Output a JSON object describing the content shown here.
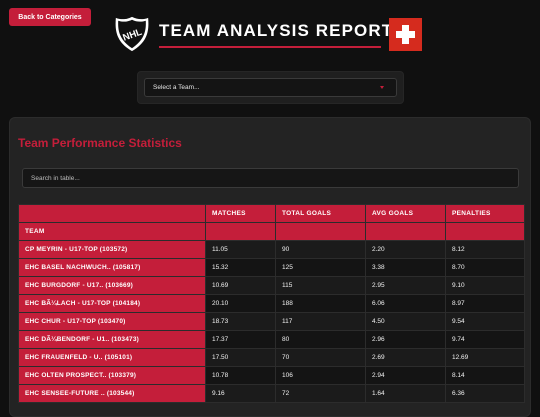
{
  "nav": {
    "back_label": "Back to Categories"
  },
  "header": {
    "title": "TEAM ANALYSIS REPORT",
    "logo_icon": "nhl-shield-icon",
    "flag_icon": "swiss-flag-icon"
  },
  "team_select": {
    "selected": "Select a Team..."
  },
  "stats": {
    "title": "Team Performance Statistics",
    "search_placeholder": "Search in table...",
    "columns": [
      "TEAM",
      "MATCHES",
      "TOTAL GOALS",
      "AVG GOALS",
      "PENALTIES"
    ],
    "rows": [
      {
        "team": "CP MEYRIN - U17-TOP (103572)",
        "matches": "11.05",
        "total_goals": "90",
        "avg_goals": "2.20",
        "penalties": "8.12"
      },
      {
        "team": "EHC BASEL NACHWUCH.. (105817)",
        "matches": "15.32",
        "total_goals": "125",
        "avg_goals": "3.38",
        "penalties": "8.70"
      },
      {
        "team": "EHC BURGDORF - U17.. (103669)",
        "matches": "10.69",
        "total_goals": "115",
        "avg_goals": "2.95",
        "penalties": "9.10"
      },
      {
        "team": "EHC BÃ¼LACH - U17-TOP (104184)",
        "matches": "20.10",
        "total_goals": "188",
        "avg_goals": "6.06",
        "penalties": "8.97"
      },
      {
        "team": "EHC CHUR - U17-TOP (103470)",
        "matches": "18.73",
        "total_goals": "117",
        "avg_goals": "4.50",
        "penalties": "9.54"
      },
      {
        "team": "EHC DÃ¼BENDORF - U1.. (103473)",
        "matches": "17.37",
        "total_goals": "80",
        "avg_goals": "2.96",
        "penalties": "9.74"
      },
      {
        "team": "EHC FRAUENFELD - U.. (105101)",
        "matches": "17.50",
        "total_goals": "70",
        "avg_goals": "2.69",
        "penalties": "12.69"
      },
      {
        "team": "EHC OLTEN PROSPECT.. (103379)",
        "matches": "10.78",
        "total_goals": "106",
        "avg_goals": "2.94",
        "penalties": "8.14"
      },
      {
        "team": "EHC SENSEE-FUTURE .. (103544)",
        "matches": "9.16",
        "total_goals": "72",
        "avg_goals": "1.64",
        "penalties": "6.36"
      }
    ]
  },
  "colors": {
    "accent": "#c41e3a",
    "background": "#101010",
    "panel": "#232323"
  }
}
